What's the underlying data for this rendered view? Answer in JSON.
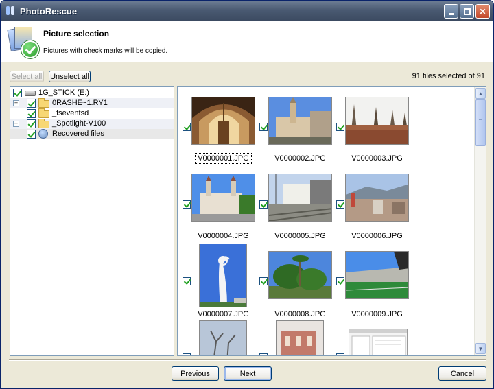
{
  "window": {
    "title": "PhotoRescue"
  },
  "header": {
    "title": "Picture selection",
    "subtitle": "Pictures with check marks will be copied."
  },
  "toolbar": {
    "select_all": "Select all",
    "unselect_all": "Unselect all",
    "files_selected": "91 files selected of 91"
  },
  "tree": {
    "root": "1G_STICK (E:)",
    "items": [
      {
        "label": "0RASHE~1.RY1",
        "expandable": true,
        "checked": true
      },
      {
        "label": "_fseventsd",
        "expandable": false,
        "checked": true
      },
      {
        "label": "_Spotlight-V100",
        "expandable": true,
        "checked": true
      },
      {
        "label": "Recovered files",
        "expandable": false,
        "checked": true
      }
    ]
  },
  "thumbnails": [
    {
      "filename": "V0000001.JPG",
      "checked": true,
      "icon": "church-interior-photo"
    },
    {
      "filename": "V0000002.JPG",
      "checked": true,
      "icon": "church-square-photo"
    },
    {
      "filename": "V0000003.JPG",
      "checked": true,
      "icon": "spires-photo"
    },
    {
      "filename": "V0000004.JPG",
      "checked": true,
      "icon": "palace-photo"
    },
    {
      "filename": "V0000005.JPG",
      "checked": true,
      "icon": "station-photo"
    },
    {
      "filename": "V0000006.JPG",
      "checked": true,
      "icon": "city-view-photo"
    },
    {
      "filename": "V0000007.JPG",
      "checked": true,
      "icon": "telecom-tower-photo"
    },
    {
      "filename": "V0000008.JPG",
      "checked": true,
      "icon": "palm-trees-photo"
    },
    {
      "filename": "V0000009.JPG",
      "checked": true,
      "icon": "stadium-photo"
    }
  ],
  "buttons": {
    "previous": "Previous",
    "next": "Next",
    "cancel": "Cancel"
  },
  "colors": {
    "accent": "#0a246a",
    "check": "#21a121",
    "panel_border": "#7f9db9"
  }
}
